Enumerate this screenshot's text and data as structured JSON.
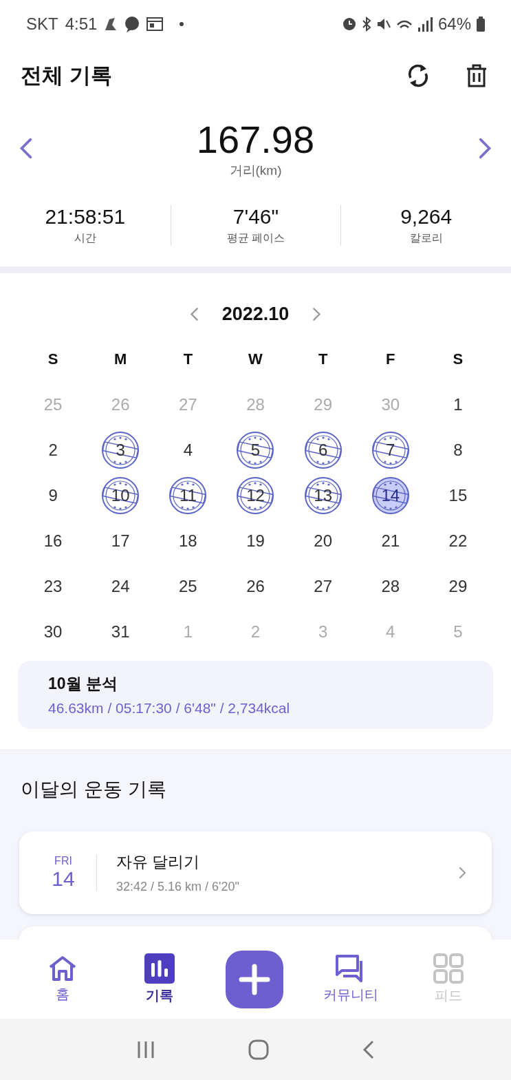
{
  "status_bar": {
    "carrier": "SKT",
    "time": "4:51",
    "battery": "64%"
  },
  "header": {
    "title": "전체 기록"
  },
  "summary": {
    "distance": "167.98",
    "distance_label": "거리(km)",
    "stats": [
      {
        "value": "21:58:51",
        "label": "시간"
      },
      {
        "value": "7'46\"",
        "label": "평균 페이스"
      },
      {
        "value": "9,264",
        "label": "칼로리"
      }
    ]
  },
  "calendar": {
    "month": "2022.10",
    "weekdays": [
      "S",
      "M",
      "T",
      "W",
      "T",
      "F",
      "S"
    ],
    "days": [
      {
        "day": "25",
        "muted": true,
        "stamped": false,
        "today": false
      },
      {
        "day": "26",
        "muted": true,
        "stamped": false,
        "today": false
      },
      {
        "day": "27",
        "muted": true,
        "stamped": false,
        "today": false
      },
      {
        "day": "28",
        "muted": true,
        "stamped": false,
        "today": false
      },
      {
        "day": "29",
        "muted": true,
        "stamped": false,
        "today": false
      },
      {
        "day": "30",
        "muted": true,
        "stamped": false,
        "today": false
      },
      {
        "day": "1",
        "muted": false,
        "stamped": false,
        "today": false
      },
      {
        "day": "2",
        "muted": false,
        "stamped": false,
        "today": false
      },
      {
        "day": "3",
        "muted": false,
        "stamped": true,
        "today": false
      },
      {
        "day": "4",
        "muted": false,
        "stamped": false,
        "today": false
      },
      {
        "day": "5",
        "muted": false,
        "stamped": true,
        "today": false
      },
      {
        "day": "6",
        "muted": false,
        "stamped": true,
        "today": false
      },
      {
        "day": "7",
        "muted": false,
        "stamped": true,
        "today": false
      },
      {
        "day": "8",
        "muted": false,
        "stamped": false,
        "today": false
      },
      {
        "day": "9",
        "muted": false,
        "stamped": false,
        "today": false
      },
      {
        "day": "10",
        "muted": false,
        "stamped": true,
        "today": false
      },
      {
        "day": "11",
        "muted": false,
        "stamped": true,
        "today": false
      },
      {
        "day": "12",
        "muted": false,
        "stamped": true,
        "today": false
      },
      {
        "day": "13",
        "muted": false,
        "stamped": true,
        "today": false
      },
      {
        "day": "14",
        "muted": false,
        "stamped": true,
        "today": true
      },
      {
        "day": "15",
        "muted": false,
        "stamped": false,
        "today": false
      },
      {
        "day": "16",
        "muted": false,
        "stamped": false,
        "today": false
      },
      {
        "day": "17",
        "muted": false,
        "stamped": false,
        "today": false
      },
      {
        "day": "18",
        "muted": false,
        "stamped": false,
        "today": false
      },
      {
        "day": "19",
        "muted": false,
        "stamped": false,
        "today": false
      },
      {
        "day": "20",
        "muted": false,
        "stamped": false,
        "today": false
      },
      {
        "day": "21",
        "muted": false,
        "stamped": false,
        "today": false
      },
      {
        "day": "22",
        "muted": false,
        "stamped": false,
        "today": false
      },
      {
        "day": "23",
        "muted": false,
        "stamped": false,
        "today": false
      },
      {
        "day": "24",
        "muted": false,
        "stamped": false,
        "today": false
      },
      {
        "day": "25",
        "muted": false,
        "stamped": false,
        "today": false
      },
      {
        "day": "26",
        "muted": false,
        "stamped": false,
        "today": false
      },
      {
        "day": "27",
        "muted": false,
        "stamped": false,
        "today": false
      },
      {
        "day": "28",
        "muted": false,
        "stamped": false,
        "today": false
      },
      {
        "day": "29",
        "muted": false,
        "stamped": false,
        "today": false
      },
      {
        "day": "30",
        "muted": false,
        "stamped": false,
        "today": false
      },
      {
        "day": "31",
        "muted": false,
        "stamped": false,
        "today": false
      },
      {
        "day": "1",
        "muted": true,
        "stamped": false,
        "today": false
      },
      {
        "day": "2",
        "muted": true,
        "stamped": false,
        "today": false
      },
      {
        "day": "3",
        "muted": true,
        "stamped": false,
        "today": false
      },
      {
        "day": "4",
        "muted": true,
        "stamped": false,
        "today": false
      },
      {
        "day": "5",
        "muted": true,
        "stamped": false,
        "today": false
      }
    ]
  },
  "analysis": {
    "title": "10월 분석",
    "detail": "46.63km / 05:17:30 / 6'48\" / 2,734kcal"
  },
  "records": {
    "title": "이달의 운동 기록",
    "items": [
      {
        "weekday": "FRI",
        "day": "14",
        "name": "자유 달리기",
        "detail": "32:42 / 5.16 km / 6'20\""
      }
    ]
  },
  "bottom_nav": [
    {
      "kind": "home",
      "label": "홈",
      "selected": false,
      "disabled": false
    },
    {
      "kind": "records",
      "label": "기록",
      "selected": true,
      "disabled": false
    },
    {
      "kind": "add",
      "selected": false,
      "disabled": false
    },
    {
      "kind": "community",
      "label": "커뮤니티",
      "selected": false,
      "disabled": false
    },
    {
      "kind": "feed",
      "label": "피드",
      "selected": false,
      "disabled": true
    }
  ]
}
